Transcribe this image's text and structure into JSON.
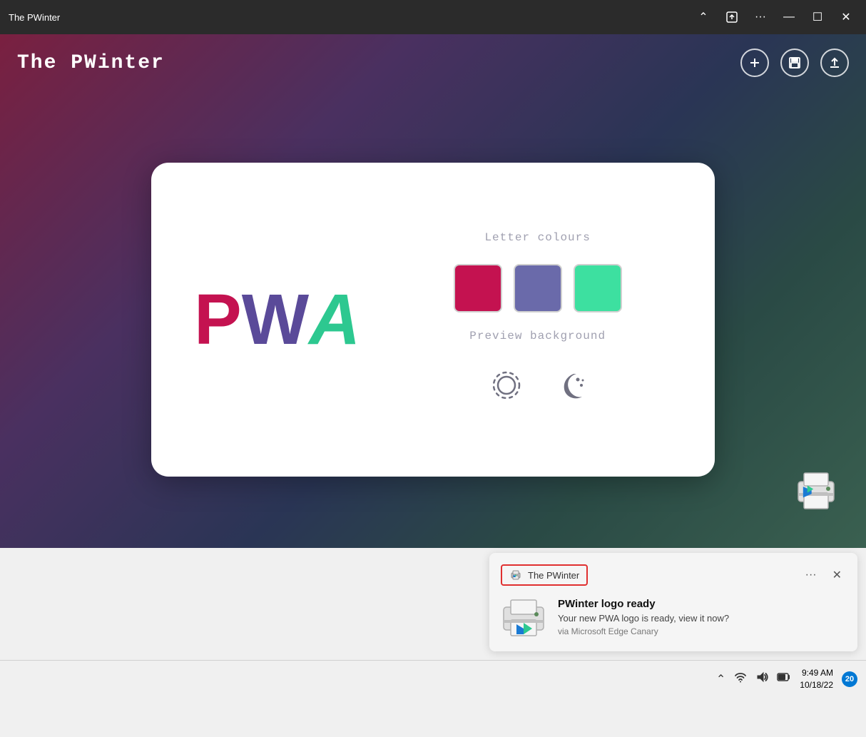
{
  "titleBar": {
    "title": "The PWinter",
    "chevron_up": "⌃",
    "share_icon": "⎗",
    "more_icon": "···",
    "minimize_icon": "—",
    "restore_icon": "☐",
    "close_icon": "✕"
  },
  "appHeader": {
    "title": "The PWinter",
    "add_icon": "+",
    "save_icon": "💾",
    "upload_icon": "⬆"
  },
  "card": {
    "letterColoursLabel": "Letter colours",
    "previewBackgroundLabel": "Preview background",
    "colours": [
      "#c41250",
      "#6a6aaa",
      "#3de0a0"
    ],
    "pwaLetters": {
      "P": "P",
      "W": "W",
      "A": "A"
    }
  },
  "taskbar": {
    "time": "9:49 AM",
    "date": "10/18/22",
    "notificationCount": "20"
  },
  "notification": {
    "appName": "The PWinter",
    "title": "PWinter logo ready",
    "message": "Your new PWA logo is ready, view it now?",
    "via": "via Microsoft Edge Canary",
    "moreBtn": "···",
    "closeBtn": "✕"
  }
}
